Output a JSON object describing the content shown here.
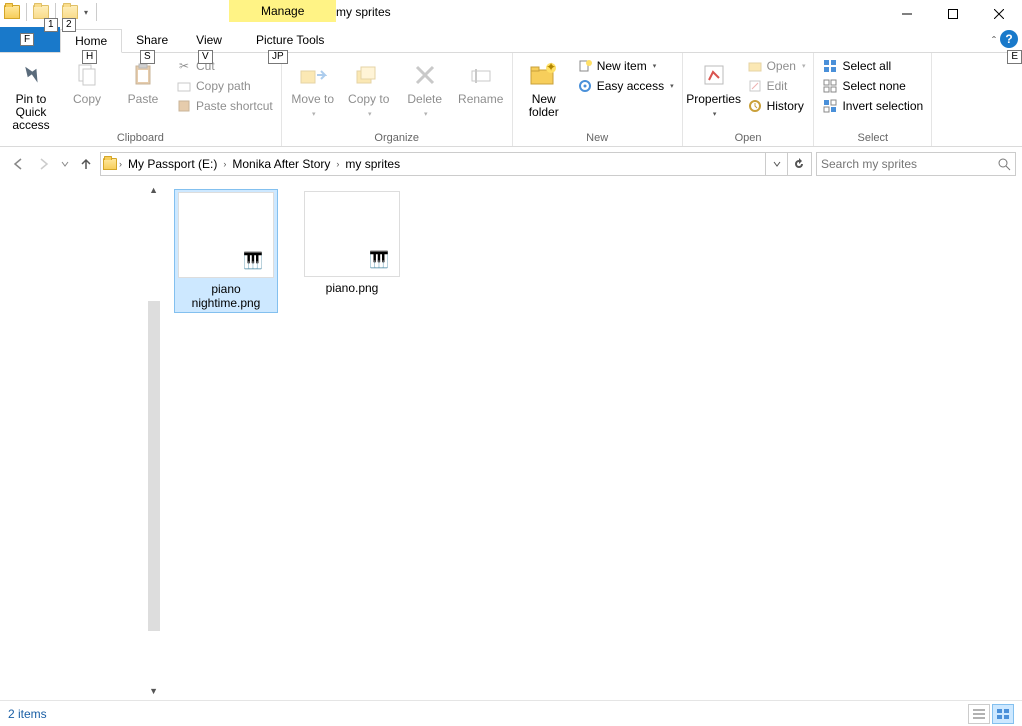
{
  "window": {
    "manage_label": "Manage",
    "title": "my sprites",
    "picture_tools": "Picture Tools"
  },
  "keytips": {
    "one": "1",
    "two": "2",
    "f": "F",
    "h": "H",
    "s": "S",
    "v": "V",
    "jp": "JP",
    "e": "E"
  },
  "tabs": {
    "file": "File",
    "home": "Home",
    "share": "Share",
    "view": "View"
  },
  "ribbon": {
    "pin": "Pin to Quick access",
    "copy": "Copy",
    "paste": "Paste",
    "cut": "Cut",
    "copy_path": "Copy path",
    "paste_shortcut": "Paste shortcut",
    "clipboard": "Clipboard",
    "move_to": "Move to",
    "copy_to": "Copy to",
    "delete": "Delete",
    "rename": "Rename",
    "organize": "Organize",
    "new_folder": "New folder",
    "new_item": "New item",
    "easy_access": "Easy access",
    "new": "New",
    "properties": "Properties",
    "open": "Open",
    "edit": "Edit",
    "history": "History",
    "open_group": "Open",
    "select_all": "Select all",
    "select_none": "Select none",
    "invert": "Invert selection",
    "select": "Select"
  },
  "breadcrumb": [
    "My Passport (E:)",
    "Monika After Story",
    "my sprites"
  ],
  "search_placeholder": "Search my sprites",
  "files": [
    {
      "name": "piano nightime.png",
      "selected": true
    },
    {
      "name": "piano.png",
      "selected": false
    }
  ],
  "status": {
    "count": "2 items"
  }
}
